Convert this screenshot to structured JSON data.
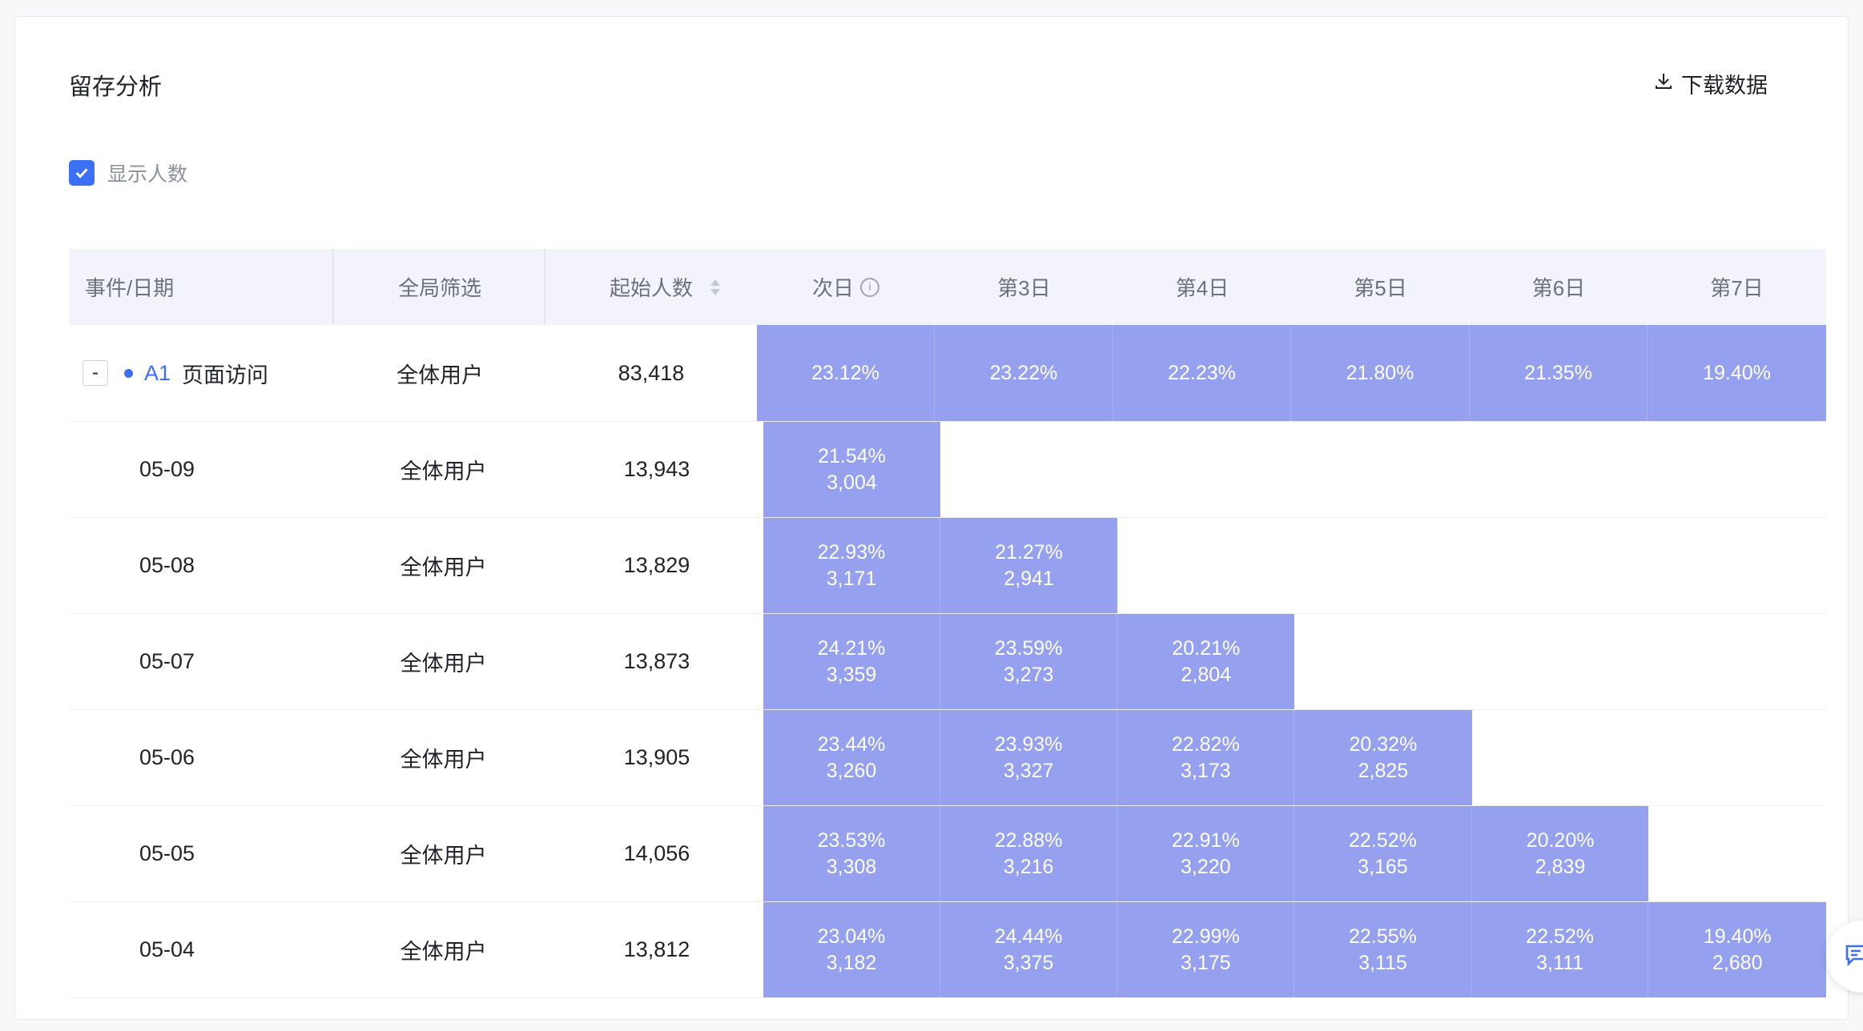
{
  "header": {
    "title": "留存分析",
    "download_label": "下载数据"
  },
  "options": {
    "show_count_label": "显示人数",
    "show_count_checked": true
  },
  "table": {
    "columns": {
      "event_date": "事件/日期",
      "filter": "全局筛选",
      "start_count": "起始人数",
      "days": [
        "次日",
        "第3日",
        "第4日",
        "第5日",
        "第6日",
        "第7日"
      ]
    },
    "group": {
      "collapse_symbol": "-",
      "event_code": "A1",
      "event_name": "页面访问",
      "filter": "全体用户",
      "start_count": "83,418",
      "rates": [
        "23.12%",
        "23.22%",
        "22.23%",
        "21.80%",
        "21.35%",
        "19.40%"
      ]
    },
    "rows": [
      {
        "date": "05-09",
        "filter": "全体用户",
        "start_count": "13,943",
        "cells": [
          [
            "21.54%",
            "3,004"
          ]
        ]
      },
      {
        "date": "05-08",
        "filter": "全体用户",
        "start_count": "13,829",
        "cells": [
          [
            "22.93%",
            "3,171"
          ],
          [
            "21.27%",
            "2,941"
          ]
        ]
      },
      {
        "date": "05-07",
        "filter": "全体用户",
        "start_count": "13,873",
        "cells": [
          [
            "24.21%",
            "3,359"
          ],
          [
            "23.59%",
            "3,273"
          ],
          [
            "20.21%",
            "2,804"
          ]
        ]
      },
      {
        "date": "05-06",
        "filter": "全体用户",
        "start_count": "13,905",
        "cells": [
          [
            "23.44%",
            "3,260"
          ],
          [
            "23.93%",
            "3,327"
          ],
          [
            "22.82%",
            "3,173"
          ],
          [
            "20.32%",
            "2,825"
          ]
        ]
      },
      {
        "date": "05-05",
        "filter": "全体用户",
        "start_count": "14,056",
        "cells": [
          [
            "23.53%",
            "3,308"
          ],
          [
            "22.88%",
            "3,216"
          ],
          [
            "22.91%",
            "3,220"
          ],
          [
            "22.52%",
            "3,165"
          ],
          [
            "20.20%",
            "2,839"
          ]
        ]
      },
      {
        "date": "05-04",
        "filter": "全体用户",
        "start_count": "13,812",
        "cells": [
          [
            "23.04%",
            "3,182"
          ],
          [
            "24.44%",
            "3,375"
          ],
          [
            "22.99%",
            "3,175"
          ],
          [
            "22.55%",
            "3,115"
          ],
          [
            "22.52%",
            "3,111"
          ],
          [
            "19.40%",
            "2,680"
          ]
        ]
      }
    ]
  },
  "colors": {
    "accent": "#3b6ff5",
    "cell_fill": "#95a1ef"
  },
  "icons": {
    "download": "download-icon",
    "sort": "sort-icon",
    "info": "info-icon",
    "feedback": "feedback-icon"
  }
}
